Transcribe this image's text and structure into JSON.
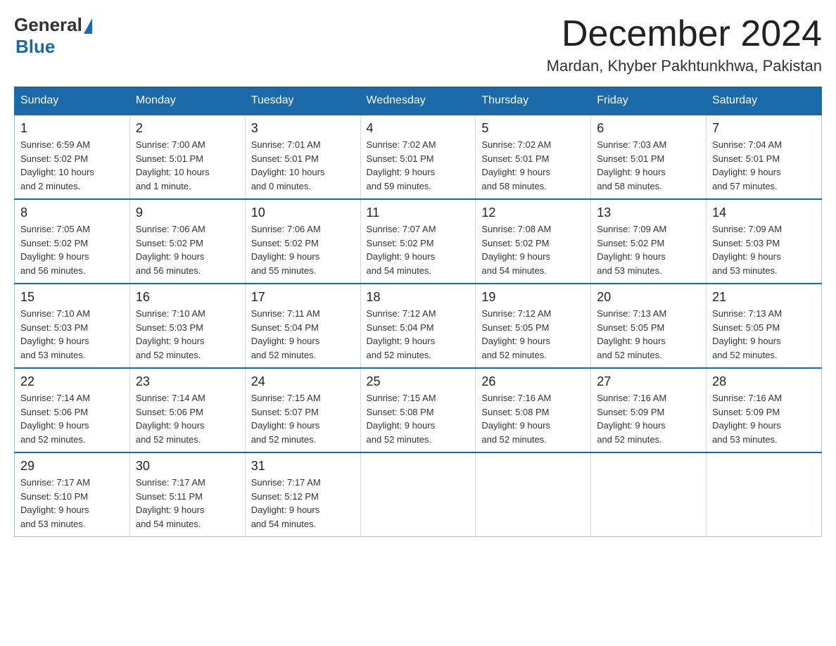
{
  "header": {
    "logo_general": "General",
    "logo_blue": "Blue",
    "month_title": "December 2024",
    "location": "Mardan, Khyber Pakhtunkhwa, Pakistan"
  },
  "columns": [
    "Sunday",
    "Monday",
    "Tuesday",
    "Wednesday",
    "Thursday",
    "Friday",
    "Saturday"
  ],
  "weeks": [
    [
      {
        "day": "1",
        "info": "Sunrise: 6:59 AM\nSunset: 5:02 PM\nDaylight: 10 hours\nand 2 minutes."
      },
      {
        "day": "2",
        "info": "Sunrise: 7:00 AM\nSunset: 5:01 PM\nDaylight: 10 hours\nand 1 minute."
      },
      {
        "day": "3",
        "info": "Sunrise: 7:01 AM\nSunset: 5:01 PM\nDaylight: 10 hours\nand 0 minutes."
      },
      {
        "day": "4",
        "info": "Sunrise: 7:02 AM\nSunset: 5:01 PM\nDaylight: 9 hours\nand 59 minutes."
      },
      {
        "day": "5",
        "info": "Sunrise: 7:02 AM\nSunset: 5:01 PM\nDaylight: 9 hours\nand 58 minutes."
      },
      {
        "day": "6",
        "info": "Sunrise: 7:03 AM\nSunset: 5:01 PM\nDaylight: 9 hours\nand 58 minutes."
      },
      {
        "day": "7",
        "info": "Sunrise: 7:04 AM\nSunset: 5:01 PM\nDaylight: 9 hours\nand 57 minutes."
      }
    ],
    [
      {
        "day": "8",
        "info": "Sunrise: 7:05 AM\nSunset: 5:02 PM\nDaylight: 9 hours\nand 56 minutes."
      },
      {
        "day": "9",
        "info": "Sunrise: 7:06 AM\nSunset: 5:02 PM\nDaylight: 9 hours\nand 56 minutes."
      },
      {
        "day": "10",
        "info": "Sunrise: 7:06 AM\nSunset: 5:02 PM\nDaylight: 9 hours\nand 55 minutes."
      },
      {
        "day": "11",
        "info": "Sunrise: 7:07 AM\nSunset: 5:02 PM\nDaylight: 9 hours\nand 54 minutes."
      },
      {
        "day": "12",
        "info": "Sunrise: 7:08 AM\nSunset: 5:02 PM\nDaylight: 9 hours\nand 54 minutes."
      },
      {
        "day": "13",
        "info": "Sunrise: 7:09 AM\nSunset: 5:02 PM\nDaylight: 9 hours\nand 53 minutes."
      },
      {
        "day": "14",
        "info": "Sunrise: 7:09 AM\nSunset: 5:03 PM\nDaylight: 9 hours\nand 53 minutes."
      }
    ],
    [
      {
        "day": "15",
        "info": "Sunrise: 7:10 AM\nSunset: 5:03 PM\nDaylight: 9 hours\nand 53 minutes."
      },
      {
        "day": "16",
        "info": "Sunrise: 7:10 AM\nSunset: 5:03 PM\nDaylight: 9 hours\nand 52 minutes."
      },
      {
        "day": "17",
        "info": "Sunrise: 7:11 AM\nSunset: 5:04 PM\nDaylight: 9 hours\nand 52 minutes."
      },
      {
        "day": "18",
        "info": "Sunrise: 7:12 AM\nSunset: 5:04 PM\nDaylight: 9 hours\nand 52 minutes."
      },
      {
        "day": "19",
        "info": "Sunrise: 7:12 AM\nSunset: 5:05 PM\nDaylight: 9 hours\nand 52 minutes."
      },
      {
        "day": "20",
        "info": "Sunrise: 7:13 AM\nSunset: 5:05 PM\nDaylight: 9 hours\nand 52 minutes."
      },
      {
        "day": "21",
        "info": "Sunrise: 7:13 AM\nSunset: 5:05 PM\nDaylight: 9 hours\nand 52 minutes."
      }
    ],
    [
      {
        "day": "22",
        "info": "Sunrise: 7:14 AM\nSunset: 5:06 PM\nDaylight: 9 hours\nand 52 minutes."
      },
      {
        "day": "23",
        "info": "Sunrise: 7:14 AM\nSunset: 5:06 PM\nDaylight: 9 hours\nand 52 minutes."
      },
      {
        "day": "24",
        "info": "Sunrise: 7:15 AM\nSunset: 5:07 PM\nDaylight: 9 hours\nand 52 minutes."
      },
      {
        "day": "25",
        "info": "Sunrise: 7:15 AM\nSunset: 5:08 PM\nDaylight: 9 hours\nand 52 minutes."
      },
      {
        "day": "26",
        "info": "Sunrise: 7:16 AM\nSunset: 5:08 PM\nDaylight: 9 hours\nand 52 minutes."
      },
      {
        "day": "27",
        "info": "Sunrise: 7:16 AM\nSunset: 5:09 PM\nDaylight: 9 hours\nand 52 minutes."
      },
      {
        "day": "28",
        "info": "Sunrise: 7:16 AM\nSunset: 5:09 PM\nDaylight: 9 hours\nand 53 minutes."
      }
    ],
    [
      {
        "day": "29",
        "info": "Sunrise: 7:17 AM\nSunset: 5:10 PM\nDaylight: 9 hours\nand 53 minutes."
      },
      {
        "day": "30",
        "info": "Sunrise: 7:17 AM\nSunset: 5:11 PM\nDaylight: 9 hours\nand 54 minutes."
      },
      {
        "day": "31",
        "info": "Sunrise: 7:17 AM\nSunset: 5:12 PM\nDaylight: 9 hours\nand 54 minutes."
      },
      null,
      null,
      null,
      null
    ]
  ]
}
